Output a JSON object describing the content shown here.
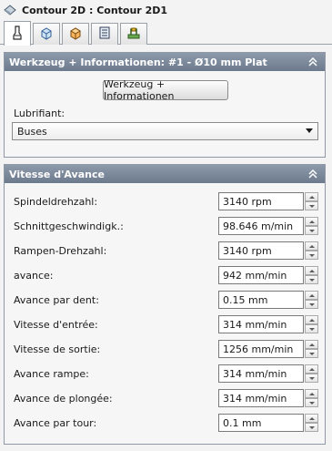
{
  "window": {
    "title": "Contour 2D : Contour 2D1",
    "title_icon": "contour-icon"
  },
  "tabs": [
    {
      "name": "tool-tab",
      "icon": "tool-icon",
      "active": true
    },
    {
      "name": "geometry-tab",
      "icon": "geometry-box-icon",
      "active": false
    },
    {
      "name": "stock-tab",
      "icon": "stock-box-icon",
      "active": false
    },
    {
      "name": "strategy-tab",
      "icon": "strategy-icon",
      "active": false
    },
    {
      "name": "linking-tab",
      "icon": "linking-icon",
      "active": false
    }
  ],
  "tool_panel": {
    "header": "Werkzeug + Informationen: #1 - Ø10 mm Plat",
    "button_label": "Werkzeug + Informationen",
    "lubrifiant_label": "Lubrifiant:",
    "lubrifiant_value": "Buses"
  },
  "feed_panel": {
    "header": "Vitesse d'Avance",
    "rows": [
      {
        "label": "Spindeldrehzahl:",
        "value": "3140 rpm"
      },
      {
        "label": "Schnittgeschwindigk.:",
        "value": "98.646 m/min"
      },
      {
        "label": "Rampen-Drehzahl:",
        "value": "3140 rpm"
      },
      {
        "label": "avance:",
        "value": "942 mm/min"
      },
      {
        "label": "Avance par dent:",
        "value": "0.15 mm"
      },
      {
        "label": "Vitesse d'entrée:",
        "value": "314 mm/min"
      },
      {
        "label": "Vitesse de sortie:",
        "value": "1256 mm/min"
      },
      {
        "label": "Avance rampe:",
        "value": "314 mm/min"
      },
      {
        "label": "Avance de plongée:",
        "value": "314 mm/min"
      },
      {
        "label": "Avance par tour:",
        "value": "0.1 mm"
      }
    ]
  },
  "colors": {
    "panel_header": "#7b8899",
    "background": "#f3f3f3"
  }
}
